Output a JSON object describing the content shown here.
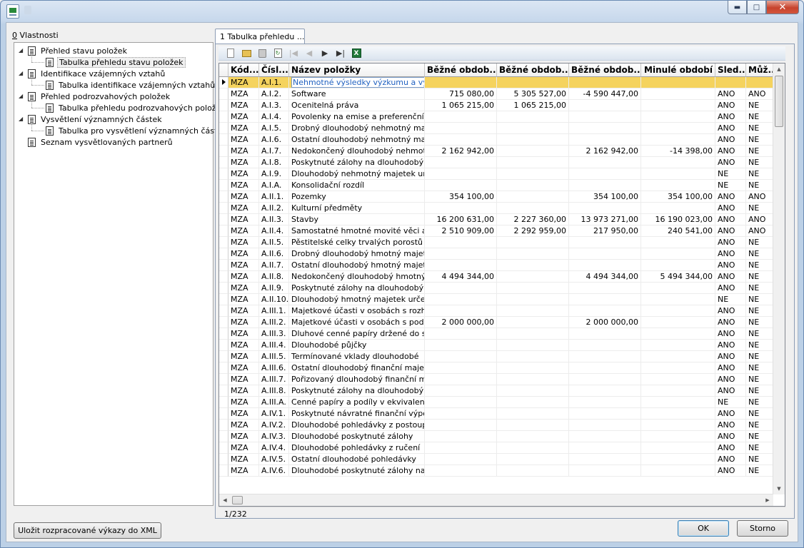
{
  "window": {
    "controls": {
      "minimize": "▬",
      "maximize": "□",
      "close": "✕"
    }
  },
  "left_panel": {
    "caption_underlined": "0",
    "caption_rest": " Vlastnosti",
    "tree": [
      {
        "label": "Přehled stavu položek",
        "level": 0,
        "expanded": true
      },
      {
        "label": "Tabulka přehledu stavu položek",
        "level": 1,
        "selected": true
      },
      {
        "label": "Identifikace vzájemných vztahů",
        "level": 0,
        "expanded": true
      },
      {
        "label": "Tabulka identifikace vzájemných vztahů",
        "level": 1
      },
      {
        "label": "Přehled podrozvahových položek",
        "level": 0,
        "expanded": true
      },
      {
        "label": "Tabulka přehledu podrozvahových položek",
        "level": 1
      },
      {
        "label": "Vysvětlení významných částek",
        "level": 0,
        "expanded": true
      },
      {
        "label": "Tabulka pro vysvětlení významných částek",
        "level": 1
      },
      {
        "label": "Seznam vysvětlovaných partnerů",
        "level": 0
      }
    ],
    "save_button": "Uložit rozpracované výkazy do XML"
  },
  "tab": {
    "label": "1 Tabulka přehledu ..."
  },
  "toolbar": {
    "icons": [
      "new-icon",
      "open-icon",
      "delete-icon",
      "refresh-icon",
      "first-record-icon",
      "previous-record-icon",
      "next-record-icon",
      "last-record-icon",
      "excel-export-icon"
    ],
    "nav_glyphs": {
      "first": "|◀",
      "prev": "◀",
      "next": "▶",
      "last": "▶|"
    }
  },
  "grid": {
    "columns": [
      "Kód...",
      "Čísl...",
      "Název položky",
      "Běžné obdob...",
      "Běžné obdob...",
      "Běžné obdob...",
      "Minulé období",
      "Sled...",
      "Můž..."
    ],
    "rows": [
      [
        "MZA",
        "A.I.1.",
        "Nehmotné výsledky výzkumu a vývoje",
        "",
        "",
        "",
        "",
        "",
        ""
      ],
      [
        "MZA",
        "A.I.2.",
        "Software",
        "715 080,00",
        "5 305 527,00",
        "-4 590 447,00",
        "",
        "ANO",
        "ANO"
      ],
      [
        "MZA",
        "A.I.3.",
        "Ocenitelná práva",
        "1 065 215,00",
        "1 065 215,00",
        "",
        "",
        "ANO",
        "NE"
      ],
      [
        "MZA",
        "A.I.4.",
        "Povolenky na emise a preferenční limity",
        "",
        "",
        "",
        "",
        "ANO",
        "NE"
      ],
      [
        "MZA",
        "A.I.5.",
        "Drobný dlouhodobý nehmotný majetek",
        "",
        "",
        "",
        "",
        "ANO",
        "NE"
      ],
      [
        "MZA",
        "A.I.6.",
        "Ostatní dlouhodobý nehmotný majetek",
        "",
        "",
        "",
        "",
        "ANO",
        "NE"
      ],
      [
        "MZA",
        "A.I.7.",
        "Nedokončený dlouhodobý nehmotný majetek",
        "2 162 942,00",
        "",
        "2 162 942,00",
        "-14 398,00",
        "ANO",
        "NE"
      ],
      [
        "MZA",
        "A.I.8.",
        "Poskytnuté zálohy na dlouhodobý nehmotný majetek",
        "",
        "",
        "",
        "",
        "ANO",
        "NE"
      ],
      [
        "MZA",
        "A.I.9.",
        "Dlouhodobý nehmotný majetek určený k prodeji",
        "",
        "",
        "",
        "",
        "NE",
        "NE"
      ],
      [
        "MZA",
        "A.I.A.",
        "Konsolidační rozdíl",
        "",
        "",
        "",
        "",
        "NE",
        "NE"
      ],
      [
        "MZA",
        "A.II.1.",
        "Pozemky",
        "354 100,00",
        "",
        "354 100,00",
        "354 100,00",
        "ANO",
        "ANO"
      ],
      [
        "MZA",
        "A.II.2.",
        "Kulturní předměty",
        "",
        "",
        "",
        "",
        "ANO",
        "NE"
      ],
      [
        "MZA",
        "A.II.3.",
        "Stavby",
        "16 200 631,00",
        "2 227 360,00",
        "13 973 271,00",
        "16 190 023,00",
        "ANO",
        "ANO"
      ],
      [
        "MZA",
        "A.II.4.",
        "Samostatné hmotné movité věci a soubory",
        "2 510 909,00",
        "2 292 959,00",
        "217 950,00",
        "240 541,00",
        "ANO",
        "ANO"
      ],
      [
        "MZA",
        "A.II.5.",
        "Pěstitelské celky trvalých porostů",
        "",
        "",
        "",
        "",
        "ANO",
        "NE"
      ],
      [
        "MZA",
        "A.II.6.",
        "Drobný dlouhodobý hmotný majetek",
        "",
        "",
        "",
        "",
        "ANO",
        "NE"
      ],
      [
        "MZA",
        "A.II.7.",
        "Ostatní dlouhodobý hmotný majetek",
        "",
        "",
        "",
        "",
        "ANO",
        "NE"
      ],
      [
        "MZA",
        "A.II.8.",
        "Nedokončený dlouhodobý hmotný majetek",
        "4 494 344,00",
        "",
        "4 494 344,00",
        "5 494 344,00",
        "ANO",
        "NE"
      ],
      [
        "MZA",
        "A.II.9.",
        "Poskytnuté zálohy na dlouhodobý hmotný majetek",
        "",
        "",
        "",
        "",
        "ANO",
        "NE"
      ],
      [
        "MZA",
        "A.II.10.",
        "Dlouhodobý hmotný majetek určený k prodeji",
        "",
        "",
        "",
        "",
        "NE",
        "NE"
      ],
      [
        "MZA",
        "A.III.1.",
        "Majetkové účasti v osobách s rozhodujícím vlivem",
        "",
        "",
        "",
        "",
        "ANO",
        "NE"
      ],
      [
        "MZA",
        "A.III.2.",
        "Majetkové účasti v osobách s podstatným vlivem",
        "2 000 000,00",
        "",
        "2 000 000,00",
        "",
        "ANO",
        "NE"
      ],
      [
        "MZA",
        "A.III.3.",
        "Dluhové cenné papíry držené do splatnosti",
        "",
        "",
        "",
        "",
        "ANO",
        "NE"
      ],
      [
        "MZA",
        "A.III.4.",
        "Dlouhodobé půjčky",
        "",
        "",
        "",
        "",
        "ANO",
        "NE"
      ],
      [
        "MZA",
        "A.III.5.",
        "Termínované vklady dlouhodobé",
        "",
        "",
        "",
        "",
        "ANO",
        "NE"
      ],
      [
        "MZA",
        "A.III.6.",
        "Ostatní dlouhodobý finanční majetek",
        "",
        "",
        "",
        "",
        "ANO",
        "NE"
      ],
      [
        "MZA",
        "A.III.7.",
        "Pořizovaný dlouhodobý finanční majetek",
        "",
        "",
        "",
        "",
        "ANO",
        "NE"
      ],
      [
        "MZA",
        "A.III.8.",
        "Poskytnuté zálohy na dlouhodobý finanční majetek",
        "",
        "",
        "",
        "",
        "ANO",
        "NE"
      ],
      [
        "MZA",
        "A.III.A.",
        "Cenné papíry a podíly v ekvivalenci",
        "",
        "",
        "",
        "",
        "NE",
        "NE"
      ],
      [
        "MZA",
        "A.IV.1.",
        "Poskytnuté návratné finanční výpomoci dlouhodobé",
        "",
        "",
        "",
        "",
        "ANO",
        "NE"
      ],
      [
        "MZA",
        "A.IV.2.",
        "Dlouhodobé pohledávky z postoupených úvěrů",
        "",
        "",
        "",
        "",
        "ANO",
        "NE"
      ],
      [
        "MZA",
        "A.IV.3.",
        "Dlouhodobé poskytnuté zálohy",
        "",
        "",
        "",
        "",
        "ANO",
        "NE"
      ],
      [
        "MZA",
        "A.IV.4.",
        "Dlouhodobé pohledávky z ručení",
        "",
        "",
        "",
        "",
        "ANO",
        "NE"
      ],
      [
        "MZA",
        "A.IV.5.",
        "Ostatní dlouhodobé pohledávky",
        "",
        "",
        "",
        "",
        "ANO",
        "NE"
      ],
      [
        "MZA",
        "A.IV.6.",
        "Dlouhodobé poskytnuté zálohy na transfery",
        "",
        "",
        "",
        "",
        "ANO",
        "NE"
      ]
    ],
    "selected_row": 0,
    "selection_color": "#f5d35e"
  },
  "status": {
    "record_position": "1/232"
  },
  "buttons": {
    "ok": "OK",
    "cancel": "Storno"
  },
  "scroll_arrows": {
    "up": "▲",
    "down": "▼",
    "left": "◀",
    "right": "▶"
  }
}
